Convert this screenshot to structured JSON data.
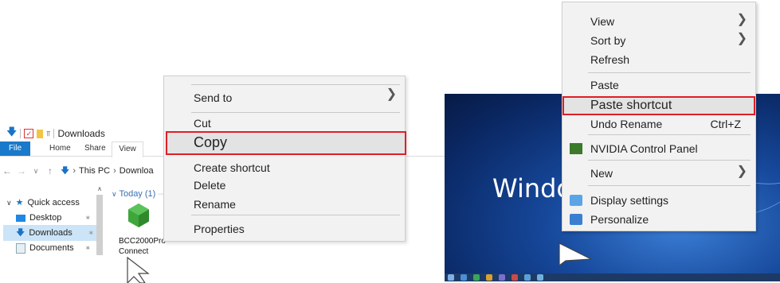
{
  "explorer": {
    "title": "Downloads",
    "ribbon_tabs": [
      "File",
      "Home",
      "Share",
      "View"
    ],
    "breadcrumb": [
      "This PC",
      "Downloa"
    ],
    "nav_items": [
      {
        "label": "Quick access"
      },
      {
        "label": "Desktop"
      },
      {
        "label": "Downloads"
      },
      {
        "label": "Documents"
      }
    ],
    "group_header": "Today (1)",
    "file_label": "BCC2000Pro Connect",
    "colors": {
      "file_tab": "#1979ca",
      "selection": "#cce4f7",
      "file_icon": "#3fa63c"
    }
  },
  "explorer_menu": {
    "items": [
      "Send to",
      "Cut",
      "Copy",
      "Create shortcut",
      "Delete",
      "Rename",
      "Properties"
    ],
    "highlighted": "Copy"
  },
  "desktop": {
    "wallpaper_text": "Windov",
    "colors": {
      "highlight_border": "#e01e26"
    }
  },
  "desktop_menu": {
    "items": [
      "View",
      "Sort by",
      "Refresh",
      "Paste",
      "Paste shortcut",
      "Undo Rename",
      "NVIDIA Control Panel",
      "New",
      "Display settings",
      "Personalize"
    ],
    "undo_shortcut": "Ctrl+Z",
    "highlighted": "Paste shortcut"
  }
}
